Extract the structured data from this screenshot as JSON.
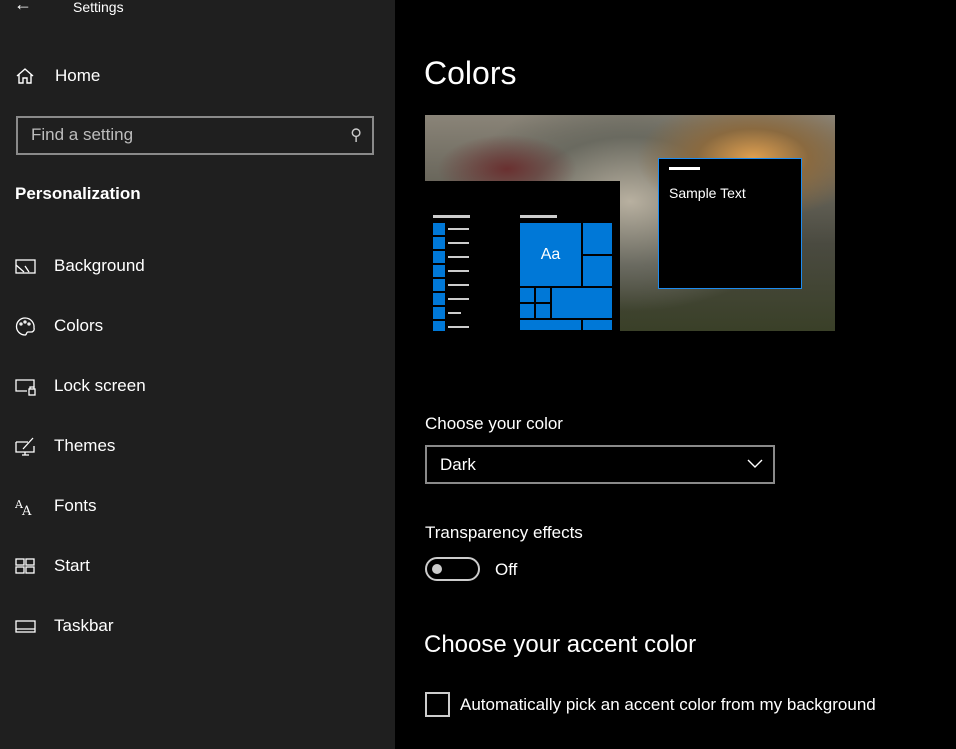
{
  "window": {
    "title": "Settings"
  },
  "sidebar": {
    "home": "Home",
    "search_placeholder": "Find a setting",
    "section": "Personalization",
    "items": [
      {
        "label": "Background",
        "icon": "picture-icon"
      },
      {
        "label": "Colors",
        "icon": "palette-icon"
      },
      {
        "label": "Lock screen",
        "icon": "lock-screen-icon"
      },
      {
        "label": "Themes",
        "icon": "themes-icon"
      },
      {
        "label": "Fonts",
        "icon": "fonts-icon"
      },
      {
        "label": "Start",
        "icon": "start-icon"
      },
      {
        "label": "Taskbar",
        "icon": "taskbar-icon"
      }
    ]
  },
  "main": {
    "title": "Colors",
    "preview": {
      "tile_text": "Aa",
      "sample_text": "Sample Text",
      "accent": "#0078d7"
    },
    "choose_color_label": "Choose your color",
    "choose_color_value": "Dark",
    "transparency_label": "Transparency effects",
    "transparency_state": "Off",
    "accent_heading": "Choose your accent color",
    "auto_accent_label": "Automatically pick an accent color from my background"
  }
}
